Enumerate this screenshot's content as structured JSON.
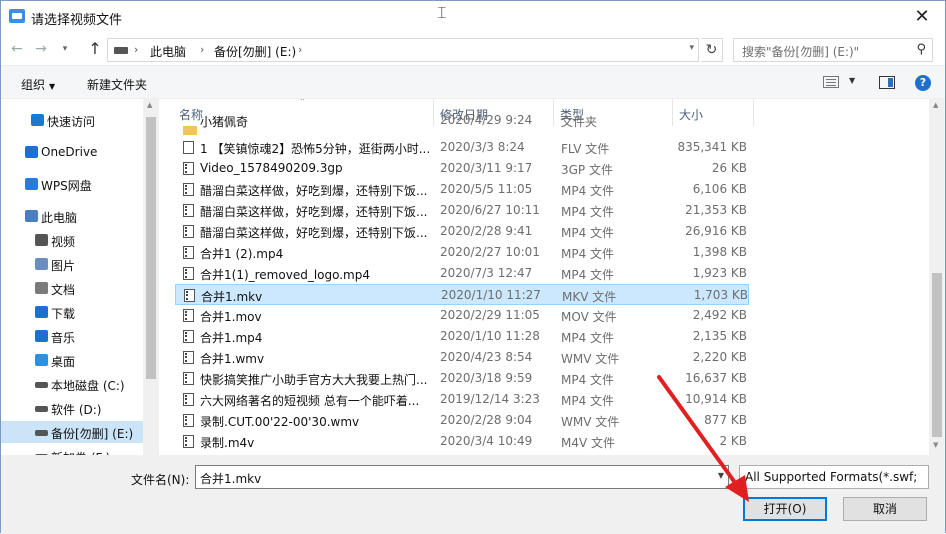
{
  "window": {
    "title": "请选择视频文件",
    "close": "✕"
  },
  "address": {
    "crumbs": [
      "此电脑",
      "备份[勿删] (E:)"
    ],
    "search_placeholder": "搜索\"备份[勿删] (E:)\""
  },
  "toolbar": {
    "organize": "组织",
    "new_folder": "新建文件夹"
  },
  "nav": {
    "items": [
      {
        "label": "快速访问",
        "icon": "star-icon",
        "color": "#1e78d2"
      },
      {
        "label": "OneDrive",
        "icon": "cloud-icon",
        "color": "#1f6fd1"
      },
      {
        "label": "WPS网盘",
        "icon": "cloud-icon",
        "color": "#2a7ad8"
      },
      {
        "label": "此电脑",
        "icon": "computer-icon",
        "color": "#4a7ec0"
      },
      {
        "label": "视频",
        "icon": "film-icon",
        "color": "#555555"
      },
      {
        "label": "图片",
        "icon": "picture-icon",
        "color": "#6a8fbf"
      },
      {
        "label": "文档",
        "icon": "document-icon",
        "color": "#7a7a7a"
      },
      {
        "label": "下载",
        "icon": "download-icon",
        "color": "#1f6fd1"
      },
      {
        "label": "音乐",
        "icon": "music-icon",
        "color": "#1f6fd1"
      },
      {
        "label": "桌面",
        "icon": "desktop-icon",
        "color": "#2c8fe0"
      },
      {
        "label": "本地磁盘 (C:)",
        "icon": "drive-icon",
        "color": "#555555"
      },
      {
        "label": "软件 (D:)",
        "icon": "drive-icon",
        "color": "#555555"
      },
      {
        "label": "备份[勿删] (E:)",
        "icon": "drive-icon",
        "color": "#555555"
      },
      {
        "label": "新加卷 (F:)",
        "icon": "drive-icon",
        "color": "#555555"
      }
    ]
  },
  "columns": {
    "name": "名称",
    "date": "修改日期",
    "type": "类型",
    "size": "大小"
  },
  "files": [
    {
      "name": "小猪佩奇",
      "date": "2020/4/29 9:24",
      "type": "文件夹",
      "size": "",
      "icon": "folder-icon",
      "partial": true
    },
    {
      "name": "1 【笑镇惊魂2】恐怖5分钟，逛街两小时...",
      "date": "2020/3/3 8:24",
      "type": "FLV 文件",
      "size": "835,341 KB",
      "icon": "file-icon"
    },
    {
      "name": "Video_1578490209.3gp",
      "date": "2020/3/11 9:17",
      "type": "3GP 文件",
      "size": "26 KB",
      "icon": "video-file-icon"
    },
    {
      "name": "醋溜白菜这样做，好吃到爆，还特别下饭...",
      "date": "2020/5/5 11:05",
      "type": "MP4 文件",
      "size": "6,106 KB",
      "icon": "video-file-icon"
    },
    {
      "name": "醋溜白菜这样做，好吃到爆，还特别下饭...",
      "date": "2020/6/27 10:11",
      "type": "MP4 文件",
      "size": "21,353 KB",
      "icon": "video-file-icon"
    },
    {
      "name": "醋溜白菜这样做，好吃到爆，还特别下饭...",
      "date": "2020/2/28 9:41",
      "type": "MP4 文件",
      "size": "26,916 KB",
      "icon": "video-file-icon"
    },
    {
      "name": "合并1 (2).mp4",
      "date": "2020/2/27 10:01",
      "type": "MP4 文件",
      "size": "1,398 KB",
      "icon": "video-file-icon"
    },
    {
      "name": "合并1(1)_removed_logo.mp4",
      "date": "2020/7/3 12:47",
      "type": "MP4 文件",
      "size": "1,923 KB",
      "icon": "video-file-icon"
    },
    {
      "name": "合并1.mkv",
      "date": "2020/1/10 11:27",
      "type": "MKV 文件",
      "size": "1,703 KB",
      "icon": "video-file-icon",
      "selected": true
    },
    {
      "name": "合并1.mov",
      "date": "2020/2/29 11:05",
      "type": "MOV 文件",
      "size": "2,492 KB",
      "icon": "video-file-icon"
    },
    {
      "name": "合并1.mp4",
      "date": "2020/1/10 11:28",
      "type": "MP4 文件",
      "size": "2,135 KB",
      "icon": "video-file-icon"
    },
    {
      "name": "合并1.wmv",
      "date": "2020/4/23 8:54",
      "type": "WMV 文件",
      "size": "2,220 KB",
      "icon": "video-file-icon"
    },
    {
      "name": "快影搞笑推广小助手官方大大我要上热门...",
      "date": "2020/3/18 9:59",
      "type": "MP4 文件",
      "size": "16,637 KB",
      "icon": "video-file-icon"
    },
    {
      "name": "六大网络著名的短视频 总有一个能吓着...",
      "date": "2019/12/14 3:23",
      "type": "MP4 文件",
      "size": "10,914 KB",
      "icon": "video-file-icon"
    },
    {
      "name": "录制.CUT.00'22-00'30.wmv",
      "date": "2020/2/28 9:04",
      "type": "WMV 文件",
      "size": "877 KB",
      "icon": "video-file-icon"
    },
    {
      "name": "录制.m4v",
      "date": "2020/3/4 10:49",
      "type": "M4V 文件",
      "size": "2 KB",
      "icon": "video-file-icon"
    }
  ],
  "bottom": {
    "filename_label": "文件名(N):",
    "filename_value": "合并1.mkv",
    "filter_value": "All Supported Formats(*.swf;",
    "open_label": "打开(O)",
    "cancel_label": "取消"
  },
  "colors": {
    "selection": "#cce8ff",
    "nav_selection": "#cce4f7",
    "accent": "#0078d7",
    "annotation_arrow": "#e02020"
  }
}
